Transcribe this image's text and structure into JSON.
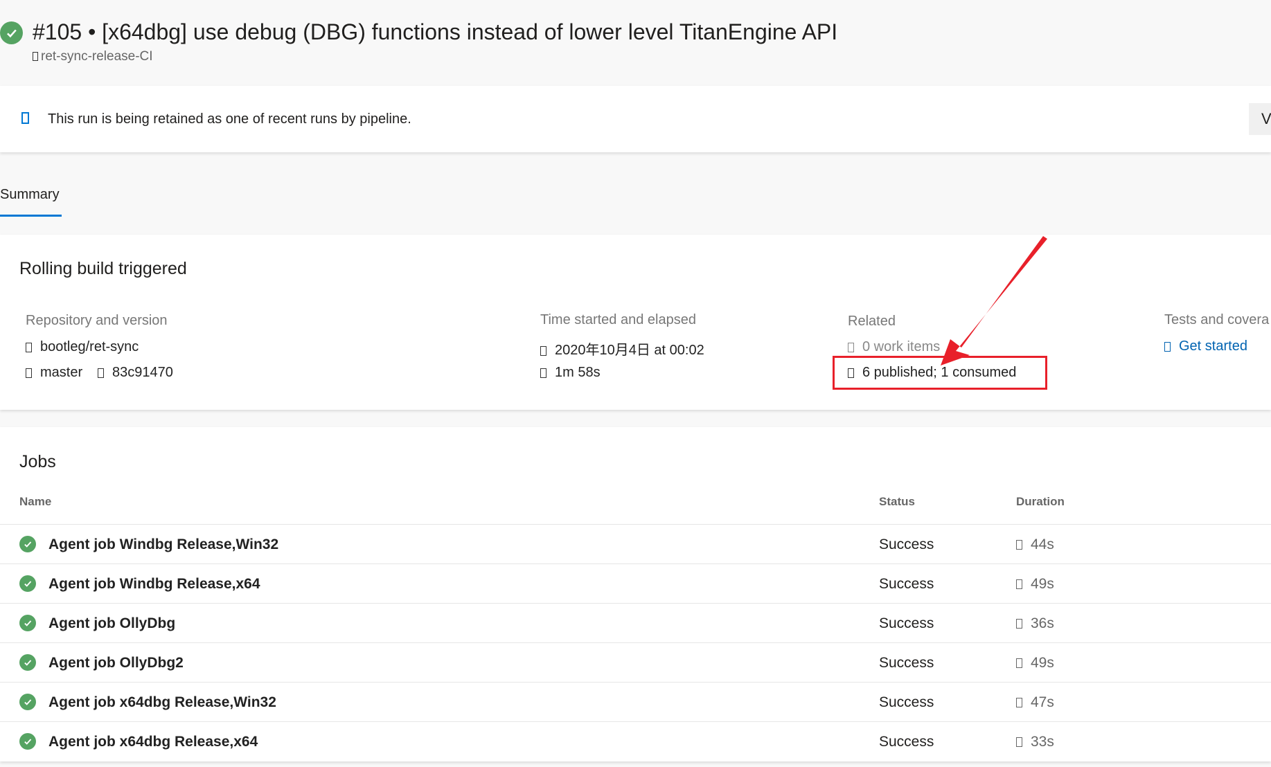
{
  "header": {
    "title": "#105 • [x64dbg] use debug (DBG) functions instead of lower level TitanEngine API",
    "pipeline": "ret-sync-release-CI",
    "status_icon": "success-check-icon"
  },
  "banner": {
    "text": "This run is being retained as one of recent runs by pipeline.",
    "button_label": "V"
  },
  "tabs": [
    {
      "label": "Summary",
      "active": true
    }
  ],
  "summary": {
    "title": "Rolling build triggered",
    "repo": {
      "label": "Repository and version",
      "repository": "bootleg/ret-sync",
      "branch": "master",
      "commit": "83c91470"
    },
    "time": {
      "label": "Time started and elapsed",
      "started": "2020年10月4日 at 00:02",
      "elapsed": "1m 58s"
    },
    "related": {
      "label": "Related",
      "work_items": "0 work items",
      "artifacts": "6 published; 1 consumed"
    },
    "tests": {
      "label": "Tests and covera",
      "link": "Get started"
    },
    "annotation_color": "#e8202a"
  },
  "jobs": {
    "title": "Jobs",
    "columns": [
      "Name",
      "Status",
      "Duration"
    ],
    "rows": [
      {
        "name": "Agent job Windbg Release,Win32",
        "status": "Success",
        "duration": "44s"
      },
      {
        "name": "Agent job Windbg Release,x64",
        "status": "Success",
        "duration": "49s"
      },
      {
        "name": "Agent job OllyDbg",
        "status": "Success",
        "duration": "36s"
      },
      {
        "name": "Agent job OllyDbg2",
        "status": "Success",
        "duration": "49s"
      },
      {
        "name": "Agent job x64dbg Release,Win32",
        "status": "Success",
        "duration": "47s"
      },
      {
        "name": "Agent job x64dbg Release,x64",
        "status": "Success",
        "duration": "33s"
      }
    ]
  }
}
